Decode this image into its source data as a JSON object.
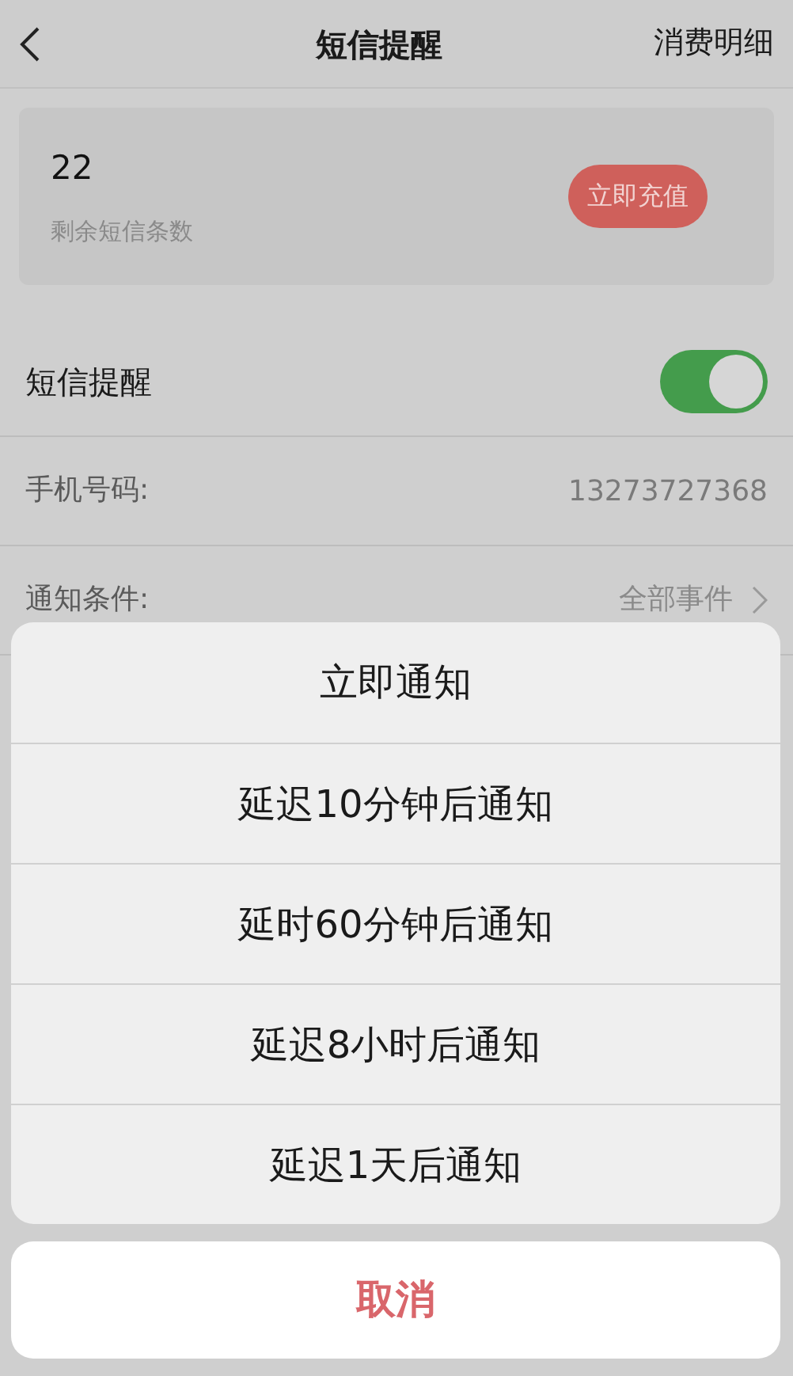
{
  "header": {
    "title": "短信提醒",
    "action": "消费明细"
  },
  "balance": {
    "count": "22",
    "label": "剩余短信条数",
    "button": "立即充值"
  },
  "settings": [
    {
      "kind": "toggle",
      "label": "短信提醒",
      "on": true
    },
    {
      "kind": "value",
      "label": "手机号码:",
      "value": "13273727368"
    },
    {
      "kind": "link",
      "label": "通知条件:",
      "value": "全部事件"
    }
  ],
  "action_sheet": {
    "options": [
      "立即通知",
      "延迟10分钟后通知",
      "延时60分钟后通知",
      "延迟8小时后通知",
      "延迟1天后通知"
    ],
    "cancel": "取消"
  }
}
